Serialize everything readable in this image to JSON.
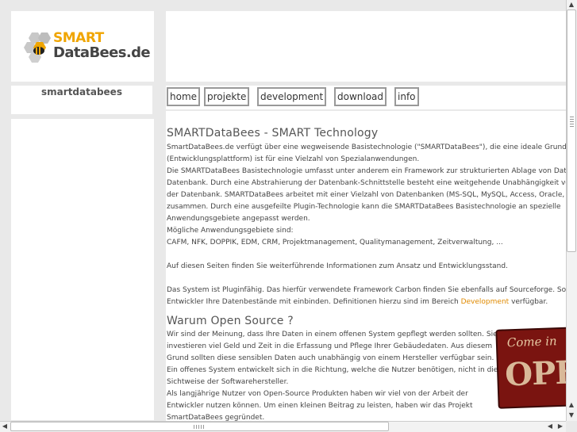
{
  "logo": {
    "line1": "SMART",
    "line2": "DataBees.de"
  },
  "sidebar": {
    "site_name": "smartdatabees"
  },
  "nav": {
    "items": [
      {
        "label": "home"
      },
      {
        "label": "projekte"
      },
      {
        "label": "development"
      },
      {
        "label": "download"
      },
      {
        "label": "info"
      }
    ]
  },
  "content": {
    "section1": {
      "title": "SMARTDataBees - SMART Technology",
      "lines": [
        "SmartDataBees.de verfügt über eine wegweisende Basistechnologie (\"SMARTDataBees\"), die eine ideale Grundlage",
        "(Entwicklungsplattform) ist für eine Vielzahl von Spezialanwendungen.",
        "Die SMARTDataBees Basistechnologie umfasst unter anderem ein Framework zur strukturierten Ablage von Daten",
        "Datenbank. Durch eine Abstrahierung der Datenbank-Schnittstelle besteht eine weitgehende Unabhängigkeit von",
        "der Datenbank. SMARTDataBees arbeitet mit einer Vielzahl von Datenbanken (MS-SQL, MySQL, Access, Oracle, ...",
        "zusammen. Durch eine ausgefeilte Plugin-Technologie kann die SMARTDataBees Basistechnologie an spezielle",
        "Anwendungsgebiete angepasst werden.",
        "Mögliche Anwendungsgebiete sind:",
        "CAFM, NFK, DOPPIK, EDM, CRM, Projektmanagement, Qualitymanagement, Zeitverwaltung, ..."
      ],
      "para2": "Auf diesen Seiten finden Sie weiterführende Informationen zum Ansatz und Entwicklungsstand.",
      "para3_line1": "Das System ist Pluginfähig. Das hierfür verwendete Framework Carbon finden Sie ebenfalls auf Sourceforge. Som",
      "para3_line2_pre": "Entwickler Ihre Datenbestände mit einbinden. Definitionen hierzu sind im Bereich",
      "para3_link": "Development",
      "para3_line2_post": "verfügbar."
    },
    "section2": {
      "title": "Warum Open Source ?",
      "lines": [
        "Wir sind der Meinung, dass Ihre Daten in einem offenen System gepflegt werden sollten. Sie",
        "investieren viel Geld und Zeit in die Erfassung und Pflege Ihrer Gebäudedaten. Aus diesem",
        "Grund sollten diese sensiblen Daten auch unabhängig von einem Hersteller verfügbar sein.",
        "Ein offenes System entwickelt sich in die Richtung, welche die Nutzer benötigen, nicht in die",
        "Sichtweise der Softwarehersteller.",
        "Als langjährige Nutzer von Open-Source Produkten haben wir viel von der Arbeit der",
        "Entwickler nutzen können. Um einen kleinen Beitrag zu leisten, haben wir das Projekt",
        "SmartDataBees gegründet."
      ]
    },
    "sign": {
      "line1": "Come in",
      "line2": "OPE"
    }
  },
  "colors": {
    "accent": "#f0a500",
    "link": "#e08a00",
    "background": "#e9e9e9"
  }
}
